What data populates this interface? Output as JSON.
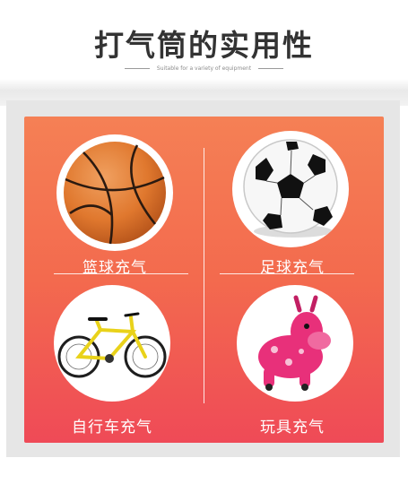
{
  "header": {
    "title": "打气筒的实用性",
    "subtitle": "Suitable for a variety of equipment"
  },
  "items": [
    {
      "label": "篮球充气",
      "icon": "basketball-icon"
    },
    {
      "label": "足球充气",
      "icon": "soccer-ball-icon"
    },
    {
      "label": "自行车充气",
      "icon": "bicycle-icon"
    },
    {
      "label": "玩具充气",
      "icon": "inflatable-toy-icon"
    }
  ],
  "colors": {
    "panel_top": "#f58055",
    "panel_bottom": "#ef4a57",
    "basketball": "#e0782e",
    "bike_frame": "#e9d21a",
    "toy": "#e8307a"
  }
}
